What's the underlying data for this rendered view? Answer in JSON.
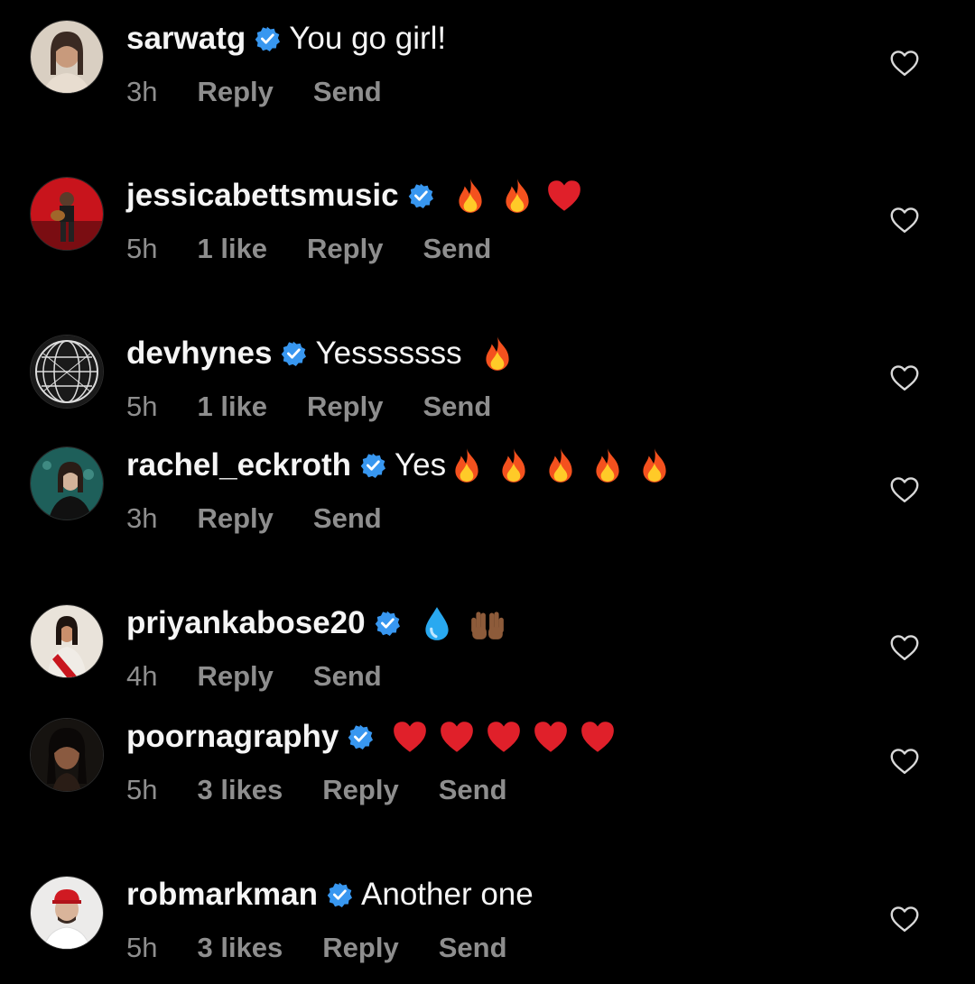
{
  "colors": {
    "background": "#000000",
    "text_primary": "#f5f5f5",
    "text_secondary": "#8e8e8e",
    "verified_blue": "#3897f0"
  },
  "comments": [
    {
      "username": "sarwatg",
      "text": "You go girl!",
      "emojis": [],
      "time": "3h",
      "likes": "",
      "reply": "Reply",
      "send": "Send",
      "avatar_icon": "woman-portrait-avatar",
      "like_icon": "heart-outline-icon"
    },
    {
      "username": "jessicabettsmusic",
      "text": "",
      "emojis": [
        "fire",
        "fire",
        "red-heart"
      ],
      "time": "5h",
      "likes": "1 like",
      "reply": "Reply",
      "send": "Send",
      "avatar_icon": "guitarist-on-red-avatar",
      "like_icon": "heart-outline-icon"
    },
    {
      "username": "devhynes",
      "text": "Yesssssss",
      "emojis": [
        "fire"
      ],
      "time": "5h",
      "likes": "1 like",
      "reply": "Reply",
      "send": "Send",
      "avatar_icon": "wireframe-globe-avatar",
      "like_icon": "heart-outline-icon"
    },
    {
      "username": "rachel_eckroth",
      "text": "Yes",
      "emojis": [
        "fire",
        "fire",
        "fire",
        "fire",
        "fire"
      ],
      "time": "3h",
      "likes": "",
      "reply": "Reply",
      "send": "Send",
      "avatar_icon": "woman-teal-background-avatar",
      "like_icon": "heart-outline-icon"
    },
    {
      "username": "priyankabose20",
      "text": "",
      "emojis": [
        "droplet",
        "raised-hands"
      ],
      "time": "4h",
      "likes": "",
      "reply": "Reply",
      "send": "Send",
      "avatar_icon": "woman-red-saree-avatar",
      "like_icon": "heart-outline-icon"
    },
    {
      "username": "poornagraphy",
      "text": "",
      "emojis": [
        "red-heart",
        "red-heart",
        "red-heart",
        "red-heart",
        "red-heart"
      ],
      "time": "5h",
      "likes": "3 likes",
      "reply": "Reply",
      "send": "Send",
      "avatar_icon": "woman-dark-portrait-avatar",
      "like_icon": "heart-outline-icon"
    },
    {
      "username": "robmarkman",
      "text": "Another one",
      "emojis": [],
      "time": "5h",
      "likes": "3 likes",
      "reply": "Reply",
      "send": "Send",
      "avatar_icon": "man-red-cap-avatar",
      "like_icon": "heart-outline-icon"
    }
  ]
}
